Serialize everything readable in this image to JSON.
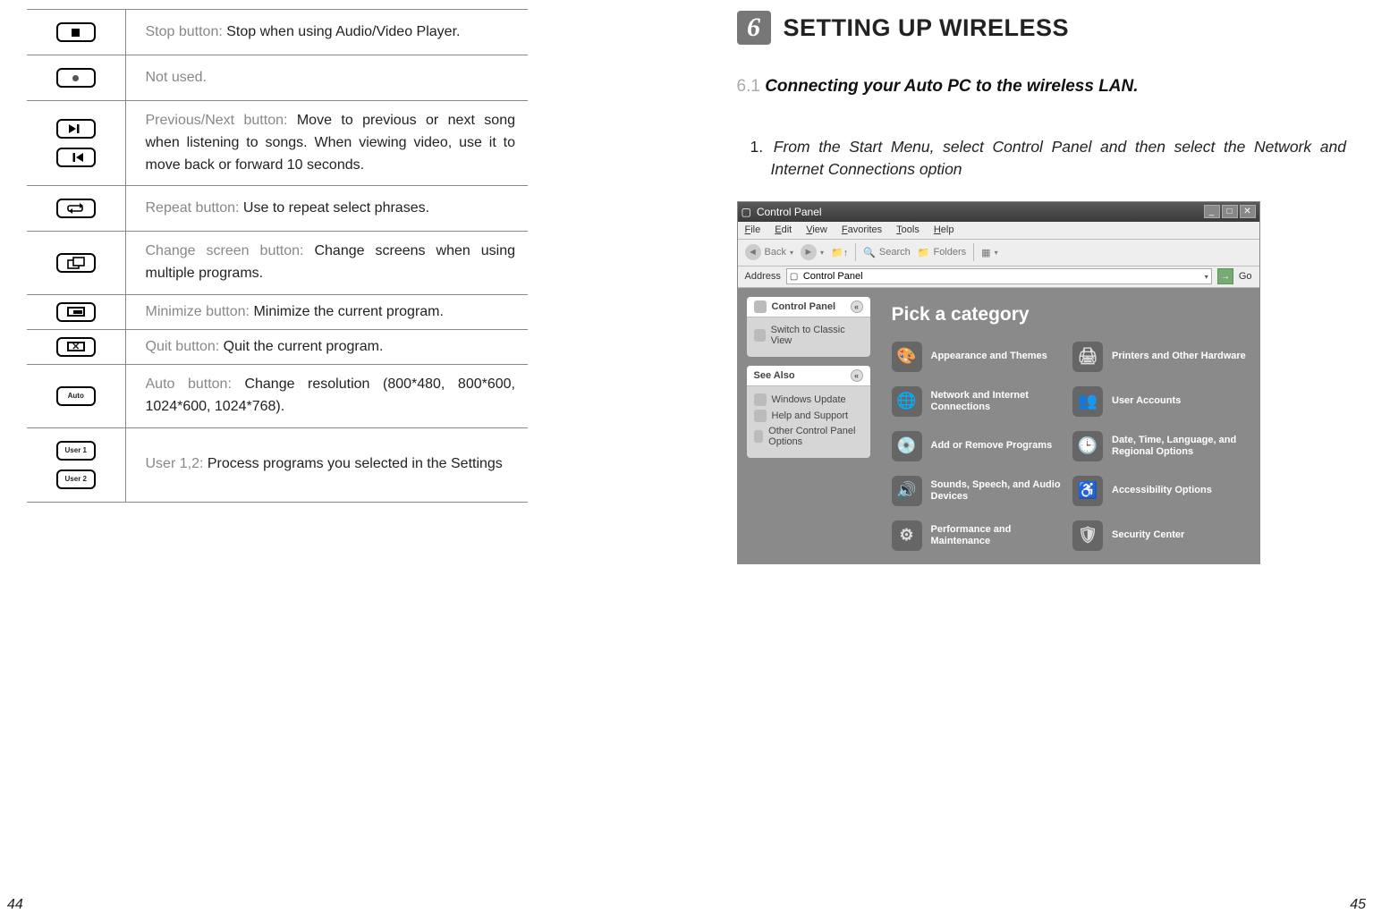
{
  "left": {
    "rows": [
      {
        "label": "Stop button: ",
        "detail": "Stop when using Audio/Video Player."
      },
      {
        "label": "",
        "detail": "Not used."
      },
      {
        "label": "Previous/Next button: ",
        "detail": "Move to previous or next song when listening to songs. When viewing video, use it to move back or forward 10 seconds."
      },
      {
        "label": "Repeat button: ",
        "detail": "Use to repeat select phrases."
      },
      {
        "label": "Change screen button: ",
        "detail": "Change screens when using multiple programs."
      },
      {
        "label": "Minimize button: ",
        "detail": "Minimize the current program."
      },
      {
        "label": "Quit button: ",
        "detail": "Quit the current program."
      },
      {
        "label": "Auto button: ",
        "detail": "Change resolution (800*480, 800*600, 1024*600, 1024*768)."
      },
      {
        "label": "User 1,2: ",
        "detail": "Process programs you selected in the Settings"
      }
    ],
    "icon_text": {
      "auto": "Auto",
      "user1": "User 1",
      "user2": "User 2"
    },
    "page_num": "44"
  },
  "right": {
    "chapter_num": "6",
    "chapter_title": "SETTING UP WIRELESS",
    "section_num": "6.1",
    "section_title": "Connecting your Auto PC to the wireless LAN.",
    "step_num": "1.",
    "step_text": "From the Start Menu, select Control Panel and then select the Network and Internet Connections option",
    "page_num": "45",
    "cp": {
      "title": "Control Panel",
      "menus": [
        "File",
        "Edit",
        "View",
        "Favorites",
        "Tools",
        "Help"
      ],
      "toolbar": {
        "back": "Back",
        "search": "Search",
        "folders": "Folders"
      },
      "address_label": "Address",
      "address_value": "Control Panel",
      "go": "Go",
      "side_panel1_title": "Control Panel",
      "side_panel1_link": "Switch to Classic View",
      "side_panel2_title": "See Also",
      "side_panel2_links": [
        "Windows Update",
        "Help and Support",
        "Other Control Panel Options"
      ],
      "main_heading": "Pick a category",
      "categories": [
        "Appearance and Themes",
        "Printers and Other Hardware",
        "Network and Internet Connections",
        "User Accounts",
        "Add or Remove Programs",
        "Date, Time, Language, and Regional Options",
        "Sounds, Speech, and Audio Devices",
        "Accessibility Options",
        "Performance and Maintenance",
        "Security Center"
      ],
      "cat_icons": [
        "🎨",
        "🖨",
        "🌐",
        "👥",
        "💿",
        "🕒",
        "🔊",
        "♿",
        "⚙",
        "🛡"
      ]
    }
  }
}
